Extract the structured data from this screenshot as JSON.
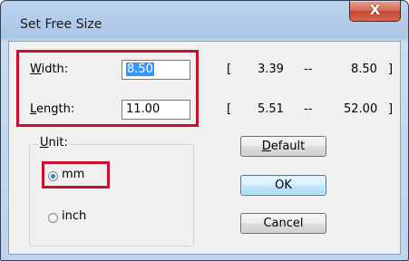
{
  "window": {
    "title": "Set Free Size",
    "close_glyph": "X"
  },
  "width_row": {
    "label_first": "W",
    "label_rest": "idth:",
    "value": "8.50",
    "range_open": "[",
    "min": "3.39",
    "sep": "--",
    "max": "8.50",
    "range_close": "]"
  },
  "length_row": {
    "label_first": "L",
    "label_rest": "ength:",
    "value": "11.00",
    "range_open": "[",
    "min": "5.51",
    "sep": "--",
    "max": "52.00",
    "range_close": "]"
  },
  "unit_group": {
    "title_first": "U",
    "title_rest": "nit:",
    "options": [
      {
        "label": "mm",
        "checked": true
      },
      {
        "label": "inch",
        "checked": false
      }
    ]
  },
  "buttons": {
    "default_first": "D",
    "default_rest": "efault",
    "ok": "OK",
    "cancel": "Cancel"
  },
  "colors": {
    "highlight": "#c8102e",
    "selection": "#3399ff"
  }
}
